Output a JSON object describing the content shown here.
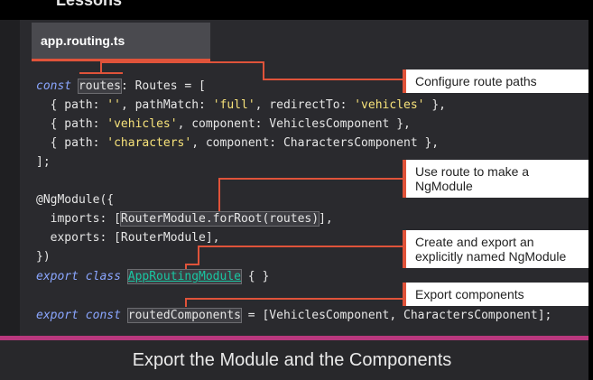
{
  "top_fragment": "Lessons",
  "file_tab": {
    "label": "app.routing.ts"
  },
  "code": {
    "l1_kw": "const",
    "l1_var": "routes",
    "l1_rest": ": Routes = [",
    "l2_a": "  { path: ",
    "l2_str1": "''",
    "l2_b": ", pathMatch: ",
    "l2_str2": "'full'",
    "l2_c": ", redirectTo: ",
    "l2_str3": "'vehicles'",
    "l2_d": " },",
    "l3_a": "  { path: ",
    "l3_str": "'vehicles'",
    "l3_b": ", component: VehiclesComponent },",
    "l4_a": "  { path: ",
    "l4_str": "'characters'",
    "l4_b": ", component: CharactersComponent },",
    "l5": "];",
    "l6": "@NgModule({",
    "l7_a": "  imports: [",
    "l7_hl": "RouterModule.forRoot(routes)",
    "l7_b": "],",
    "l8": "  exports: [RouterModule],",
    "l9": "})",
    "l10_kw": "export class",
    "l10_link": "AppRoutingModule",
    "l10_b": " { }",
    "l11_kw": "export const",
    "l11_hl": "routedComponents",
    "l11_b": " = [VehiclesComponent, CharactersComponent];"
  },
  "callouts": [
    {
      "text": "Configure route paths"
    },
    {
      "line1": "Use route to make a",
      "line2": "NgModule"
    },
    {
      "line1": "Create and export  an",
      "line2": "explicitly named NgModule"
    },
    {
      "text": "Export components"
    }
  ],
  "caption": "Export the Module and the Components",
  "colors": {
    "accent": "#e0533a",
    "keyword": "#8aa6ff",
    "string": "#f7e27a",
    "link": "#19c6a2",
    "rule": "#b9387e"
  }
}
